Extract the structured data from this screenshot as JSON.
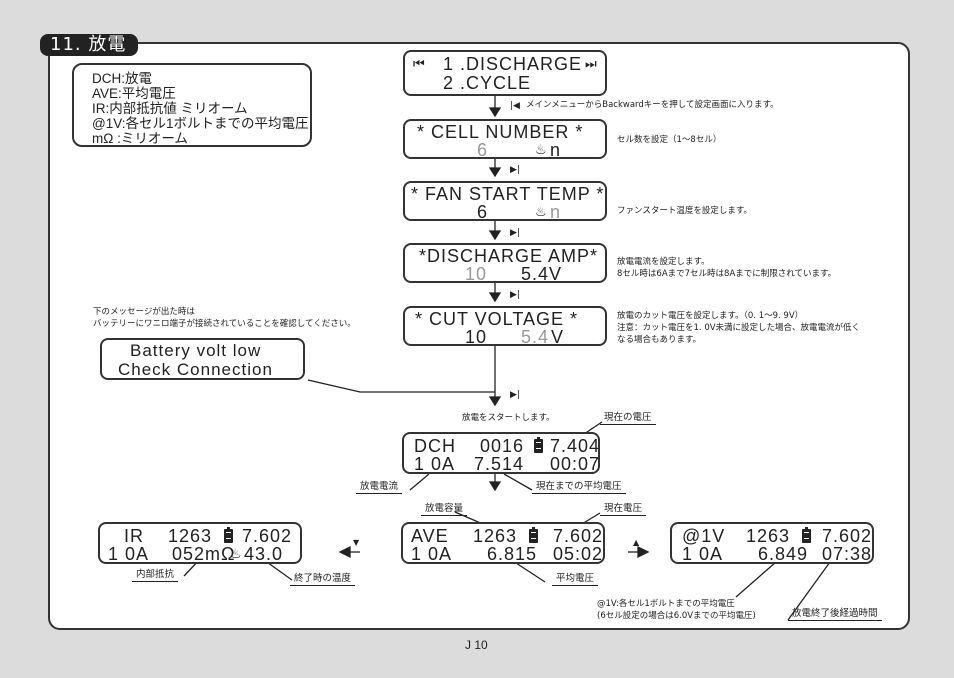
{
  "section": {
    "title": "11. 放電"
  },
  "legend": [
    "DCH:放電",
    "AVE:平均電圧",
    "IR:内部抵抗値 ミリオーム",
    "@1V:各セル1ボルトまでの平均電圧",
    "mΩ :ミリオーム"
  ],
  "screens": {
    "menu": {
      "row1": "1 .DISCHARGE",
      "row2": "2 .CYCLE",
      "left_icon": "skip-back-icon",
      "right_icon": "skip-forward-icon"
    },
    "cell_number": {
      "title": "* CELL NUMBER *",
      "value": "6",
      "unit": "n",
      "value_state": "selected-grey"
    },
    "fan_start_temp": {
      "title": "* FAN START TEMP *",
      "value": "6",
      "unit": "n"
    },
    "discharge_amp": {
      "title": "*DISCHARGE AMP*",
      "current": "10",
      "voltage": "5.4V"
    },
    "cut_voltage": {
      "title": "*  CUT VOLTAGE  *",
      "current": "10",
      "voltage_num": "5.4",
      "voltage_unit": "V"
    },
    "warning": {
      "row1": "Battery volt low",
      "row2": "Check Connection"
    },
    "dch": {
      "mode": "DCH",
      "capacity": "0016",
      "voltage": "7.404",
      "current": "1 0A",
      "avg": "7.514",
      "time": "00:07"
    },
    "ave": {
      "mode": "AVE",
      "capacity": "1263",
      "voltage": "7.602",
      "current": "1 0A",
      "avg": "6.815",
      "time": "05:02"
    },
    "ir": {
      "mode": "IR",
      "capacity": "1263",
      "voltage": "7.602",
      "current": "1 0A",
      "resistance": "052mΩ",
      "temp": "43.0"
    },
    "at1v": {
      "mode": "@1V",
      "capacity": "1263",
      "voltage": "7.602",
      "current": "1 0A",
      "avg": "6.849",
      "time": "07:38"
    }
  },
  "notes": {
    "backward": "メインメニューからBackwardキーを押して設定画面に入ります。",
    "cell_number": "セル数を設定（1～8セル）",
    "fan_start": "ファンスタート温度を設定します。",
    "discharge_amp_1": "放電電流を設定します。",
    "discharge_amp_2": "8セル時は6Aまで7セル時は8Aまでに制限されています。",
    "cut_voltage_1": "放電のカット電圧を設定します。（0. 1～9. 9V）",
    "cut_voltage_2": "注意：カット電圧を1. 0V未満に設定した場合、放電電流が低く",
    "cut_voltage_3": "なる場合もあります。",
    "warning_1": "下のメッセージが出た時は",
    "warning_2": "バッテリーにワニロ端子が接続されていることを確認してください。",
    "start": "放電をスタートします。",
    "at1v_1": "@1V:各セル1ボルトまでの平均電圧",
    "at1v_2": "(6セル設定の場合は6.0Vまでの平均電圧)"
  },
  "callouts": {
    "current_voltage_dch": "現在の電圧",
    "discharge_current": "放電電流",
    "avg_so_far": "現在までの平均電圧",
    "capacity": "放電容量",
    "current_voltage": "現在電圧",
    "avg_voltage": "平均電圧",
    "internal_resistance": "内部抵抗",
    "end_temp": "終了時の温度",
    "elapsed": "放電終了後経過時間"
  },
  "keys": {
    "forward": "▶|",
    "backward": "|◀",
    "down": "▼",
    "up": "▲"
  },
  "page": {
    "number": "J 10"
  }
}
